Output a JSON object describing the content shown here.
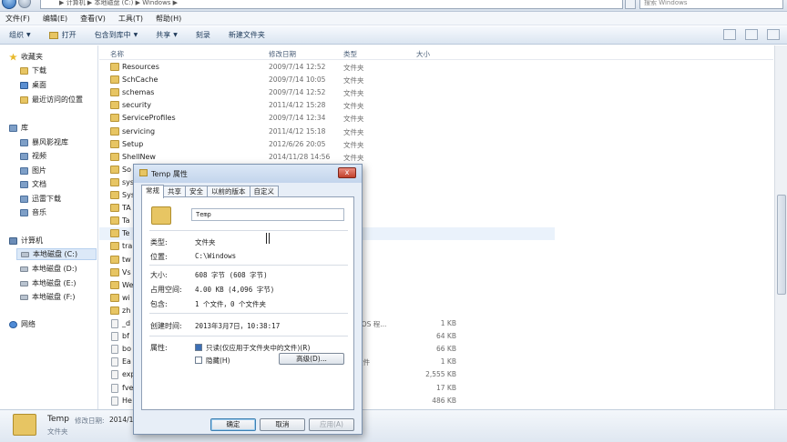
{
  "address": {
    "path": "▶ 计算机 ▶ 本地磁盘 (C:) ▶ Windows ▶"
  },
  "search": {
    "placeholder": "搜索 Windows"
  },
  "menubar": [
    "文件(F)",
    "编辑(E)",
    "查看(V)",
    "工具(T)",
    "帮助(H)"
  ],
  "commands": {
    "organize": "组织",
    "open": "打开",
    "include": "包含到库中",
    "share": "共享",
    "burn": "刻录",
    "new_folder": "新建文件夹"
  },
  "nav": {
    "favorites": "收藏夹",
    "downloads": "下载",
    "desktop": "桌面",
    "recent": "最近访问的位置",
    "libraries": "库",
    "baofeng": "暴风影视库",
    "videos": "视频",
    "pictures": "图片",
    "documents": "文档",
    "xunlei": "迅雷下载",
    "music": "音乐",
    "computer": "计算机",
    "drive_c": "本地磁盘 (C:)",
    "drive_d": "本地磁盘 (D:)",
    "drive_e": "本地磁盘 (E:)",
    "drive_f": "本地磁盘 (F:)",
    "network": "网络"
  },
  "columns": {
    "name": "名称",
    "date": "修改日期",
    "type": "类型",
    "size": "大小"
  },
  "files": [
    {
      "name": "Resources",
      "date": "2009/7/14 12:52",
      "type": "文件夹",
      "size": ""
    },
    {
      "name": "SchCache",
      "date": "2009/7/14 10:05",
      "type": "文件夹",
      "size": ""
    },
    {
      "name": "schemas",
      "date": "2009/7/14 12:52",
      "type": "文件夹",
      "size": ""
    },
    {
      "name": "security",
      "date": "2011/4/12 15:28",
      "type": "文件夹",
      "size": ""
    },
    {
      "name": "ServiceProfiles",
      "date": "2009/7/14 12:34",
      "type": "文件夹",
      "size": ""
    },
    {
      "name": "servicing",
      "date": "2011/4/12 15:18",
      "type": "文件夹",
      "size": ""
    },
    {
      "name": "Setup",
      "date": "2012/6/26 20:05",
      "type": "文件夹",
      "size": ""
    },
    {
      "name": "ShellNew",
      "date": "2014/11/28 14:56",
      "type": "文件夹",
      "size": ""
    },
    {
      "name": "So",
      "date": "",
      "type": "",
      "size": ""
    },
    {
      "name": "sys",
      "date": "",
      "type": "",
      "size": ""
    },
    {
      "name": "Sys",
      "date": "",
      "type": "",
      "size": ""
    },
    {
      "name": "TA",
      "date": "",
      "type": "",
      "size": ""
    },
    {
      "name": "Ta",
      "date": "",
      "type": "",
      "size": ""
    },
    {
      "name": "Te",
      "date": "",
      "type": "",
      "size": ""
    },
    {
      "name": "tra",
      "date": "",
      "type": "",
      "size": ""
    },
    {
      "name": "tw",
      "date": "",
      "type": "",
      "size": ""
    },
    {
      "name": "Vs",
      "date": "",
      "type": "",
      "size": ""
    },
    {
      "name": "We",
      "date": "",
      "type": "",
      "size": ""
    },
    {
      "name": "wi",
      "date": "",
      "type": "",
      "size": ""
    },
    {
      "name": "zh",
      "date": "",
      "type": "",
      "size": ""
    },
    {
      "name": "_d",
      "date": "",
      "type": "MS-DOS 程...",
      "size": "1 KB"
    },
    {
      "name": "bf",
      "date": "",
      "type": "序",
      "size": "64 KB"
    },
    {
      "name": "bo",
      "date": "",
      "type": "文件",
      "size": "66 KB"
    },
    {
      "name": "Ea",
      "date": "",
      "type": "OG 文件",
      "size": "1 KB"
    },
    {
      "name": "exp",
      "date": "",
      "type": "",
      "size": "2,555 KB"
    },
    {
      "name": "fve",
      "date": "",
      "type": "",
      "size": "17 KB"
    },
    {
      "name": "He",
      "date": "",
      "type": "",
      "size": "486 KB"
    }
  ],
  "details": {
    "name": "Temp",
    "date_label": "修改日期:",
    "date": "2014/1",
    "type": "文件夹"
  },
  "dialog": {
    "title": "Temp 属性",
    "close": "x",
    "tabs": [
      "常规",
      "共享",
      "安全",
      "以前的版本",
      "自定义"
    ],
    "name": "Temp",
    "type_label": "类型:",
    "type_value": "文件夹",
    "location_label": "位置:",
    "location_value": "C:\\Windows",
    "size_label": "大小:",
    "size_value": "608 字节 (608 字节)",
    "disk_label": "占用空间:",
    "disk_value": "4.00 KB (4,096 字节)",
    "contains_label": "包含:",
    "contains_value": "1 个文件，0 个文件夹",
    "created_label": "创建时间:",
    "created_value": "2013年3月7日，10:38:17",
    "attr_label": "属性:",
    "readonly_label": "只读(仅应用于文件夹中的文件)(R)",
    "hidden_label": "隐藏(H)",
    "advanced": "高级(D)...",
    "ok": "确定",
    "cancel": "取消",
    "apply": "应用(A)"
  }
}
